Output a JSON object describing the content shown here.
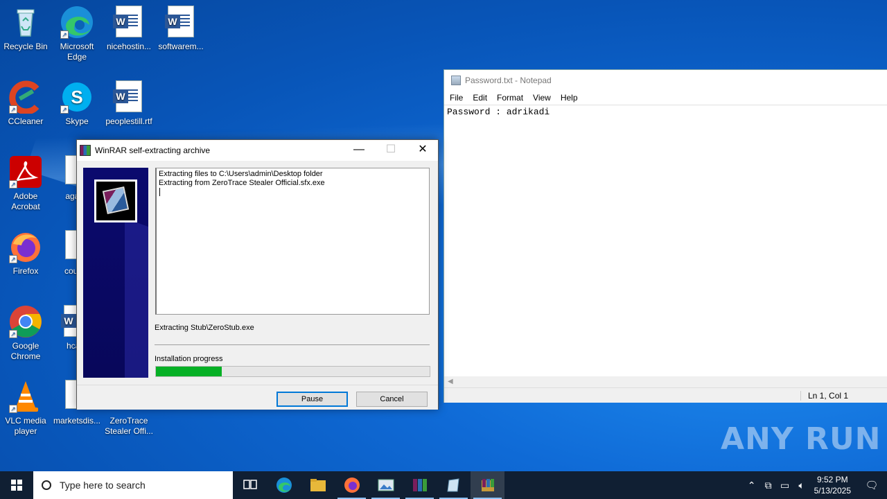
{
  "desktop": {
    "icons": [
      {
        "label": "Recycle Bin",
        "icon": "recycle-bin-icon"
      },
      {
        "label": "Microsoft Edge",
        "icon": "edge-icon"
      },
      {
        "label": "nicehostin...",
        "icon": "word-doc-icon"
      },
      {
        "label": "softwarem...",
        "icon": "word-doc-icon"
      },
      {
        "label": "CCleaner",
        "icon": "ccleaner-icon"
      },
      {
        "label": "Skype",
        "icon": "skype-icon"
      },
      {
        "label": "peoplestill.rtf",
        "icon": "word-doc-icon"
      },
      {
        "label": "Adobe Acrobat",
        "icon": "acrobat-icon"
      },
      {
        "label": "againr",
        "icon": "image-file-icon"
      },
      {
        "label": "Firefox",
        "icon": "firefox-icon"
      },
      {
        "label": "course",
        "icon": "image-file-icon"
      },
      {
        "label": "Google Chrome",
        "icon": "chrome-icon"
      },
      {
        "label": "hcaro",
        "icon": "word-doc-icon"
      },
      {
        "label": "VLC media player",
        "icon": "vlc-icon"
      },
      {
        "label": "marketsdis...",
        "icon": "image-file-icon"
      },
      {
        "label": "ZeroTrace Stealer Offi...",
        "icon": "archive-icon"
      }
    ]
  },
  "notepad": {
    "title": "Password.txt - Notepad",
    "menu": [
      "File",
      "Edit",
      "Format",
      "View",
      "Help"
    ],
    "content": "Password : adrikadi",
    "status_position": "Ln 1, Col 1"
  },
  "winrar": {
    "title": "WinRAR self-extracting archive",
    "log_lines": [
      "Extracting files to C:\\Users\\admin\\Desktop folder",
      "Extracting from ZeroTrace Stealer Official.sfx.exe"
    ],
    "current_file": "Extracting Stub\\ZeroStub.exe",
    "progress_label": "Installation progress",
    "progress_fraction": 0.24,
    "progress_color": "#06b025",
    "pause_label": "Pause",
    "cancel_label": "Cancel"
  },
  "watermark": "ANY RUN",
  "taskbar": {
    "search_placeholder": "Type here to search",
    "apps": [
      "task-view-icon",
      "edge-icon",
      "file-explorer-icon",
      "firefox-icon",
      "image-viewer-icon",
      "winrar-icon",
      "notepad-icon",
      "winrar-sfx-icon"
    ],
    "time": "9:52 PM",
    "date": "5/13/2025"
  }
}
